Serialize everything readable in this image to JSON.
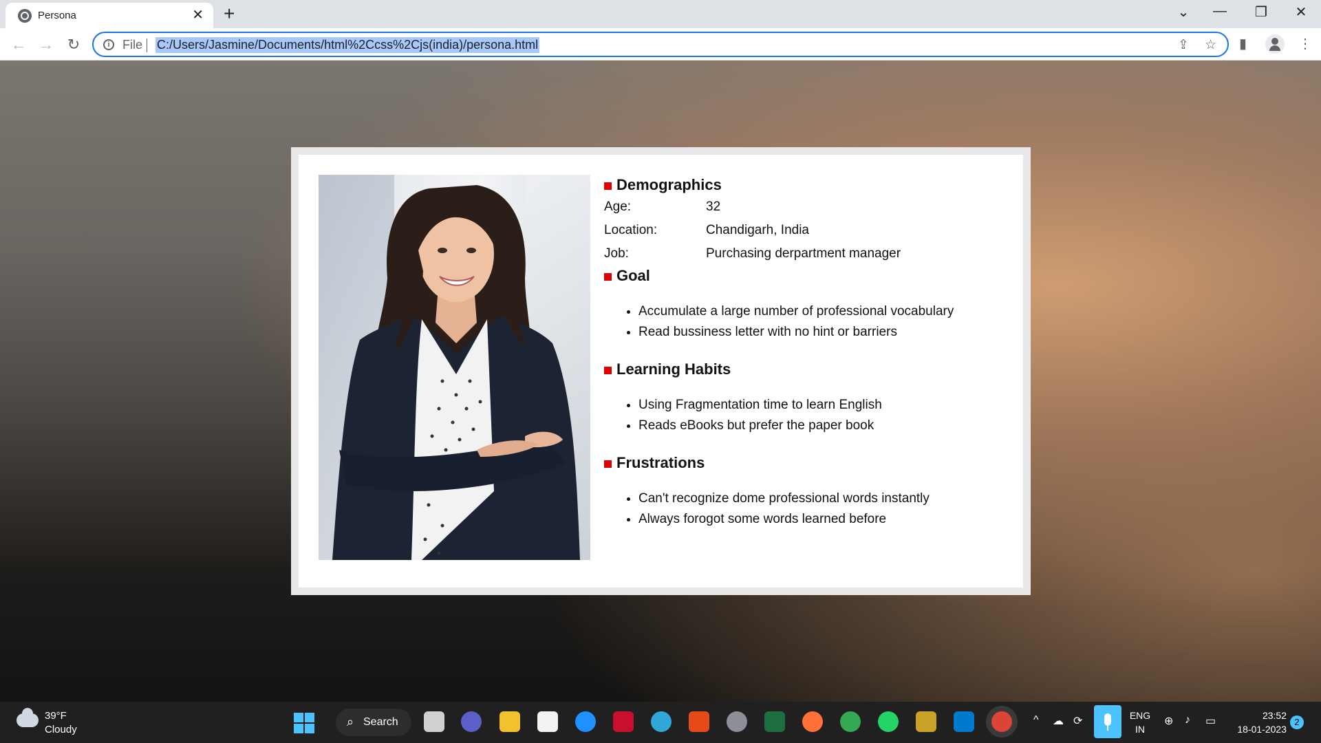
{
  "browser": {
    "tab_title": "Persona",
    "close_glyph": "✕",
    "new_tab_glyph": "+",
    "file_label": "File",
    "url": "C:/Users/Jasmine/Documents/html%2Ccss%2Cjs(india)/persona.html"
  },
  "persona": {
    "demographics": {
      "heading": "Demographics",
      "rows": [
        {
          "label": "Age:",
          "value": "32"
        },
        {
          "label": "Location:",
          "value": "Chandigarh, India"
        },
        {
          "label": "Job:",
          "value": "Purchasing derpartment manager"
        }
      ]
    },
    "goal": {
      "heading": "Goal",
      "items": [
        "Accumulate a large number of professional vocabulary",
        "Read bussiness letter with no hint or barriers"
      ]
    },
    "learning_habits": {
      "heading": "Learning Habits",
      "items": [
        "Using Fragmentation time to learn English",
        "Reads eBooks but prefer the paper book"
      ]
    },
    "frustrations": {
      "heading": "Frustrations",
      "items": [
        "Can't recognize dome professional words instantly",
        "Always forogot some words learned before"
      ]
    }
  },
  "colors": {
    "accent_bullet": "#e00000",
    "omnibox_border": "#1a73e8"
  },
  "taskbar": {
    "weather_temp": "39°F",
    "weather_desc": "Cloudy",
    "search_label": "Search",
    "lang_line1": "ENG",
    "lang_line2": "IN",
    "time": "23:52",
    "date": "18-01-2023",
    "notification_count": "2"
  }
}
